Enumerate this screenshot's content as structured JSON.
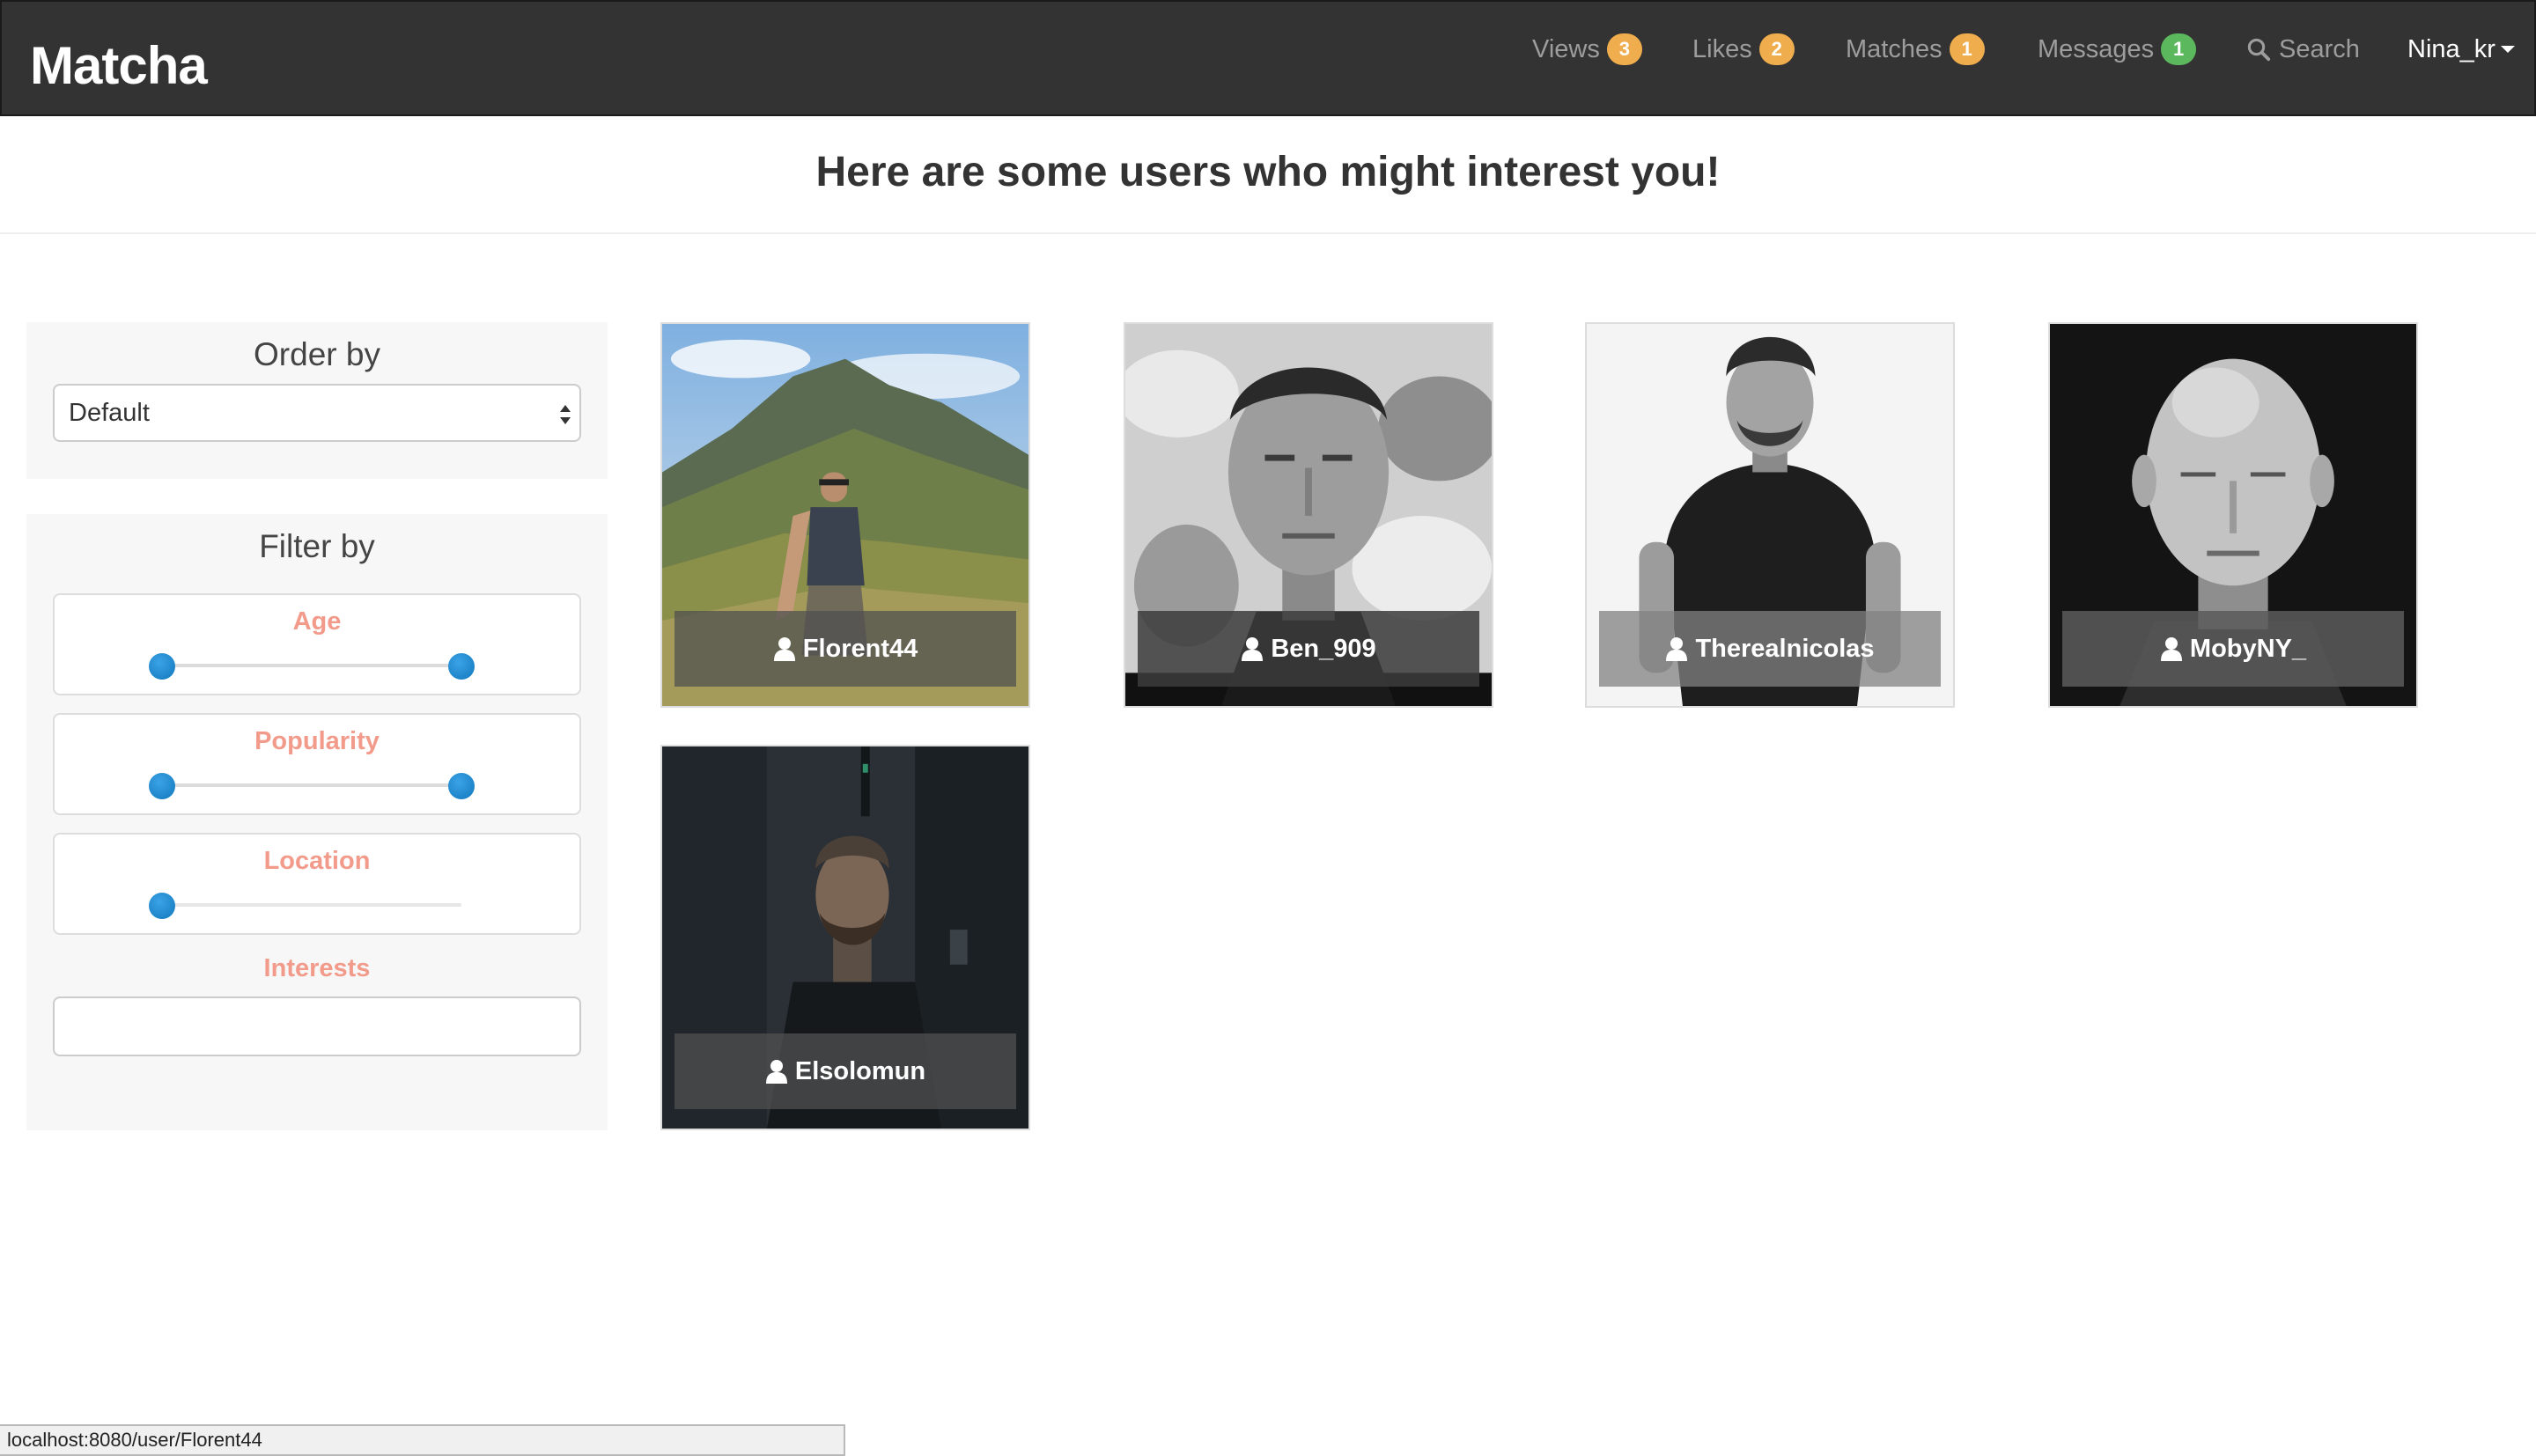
{
  "navbar": {
    "brand": "Matcha",
    "items": [
      {
        "label": "Views",
        "badge": "3",
        "badge_color": "#f0ad4e"
      },
      {
        "label": "Likes",
        "badge": "2",
        "badge_color": "#f0ad4e"
      },
      {
        "label": "Matches",
        "badge": "1",
        "badge_color": "#f0ad4e"
      },
      {
        "label": "Messages",
        "badge": "1",
        "badge_color": "#5cb85c"
      }
    ],
    "search_label": "Search",
    "search_icon": "search-icon",
    "user": "Nina_kr"
  },
  "headline": "Here are some users who might interest you!",
  "sidebar": {
    "order_title": "Order by",
    "order_selected": "Default",
    "filter_title": "Filter by",
    "filters": [
      {
        "label": "Age",
        "handles": [
          0.0,
          1.0
        ]
      },
      {
        "label": "Popularity",
        "handles": [
          0.0,
          1.0
        ]
      },
      {
        "label": "Location",
        "handles": [
          0.0
        ]
      }
    ],
    "interests_label": "Interests",
    "interests_value": ""
  },
  "users": [
    {
      "username": "Florent44",
      "photo_theme": "mountain-landscape"
    },
    {
      "username": "Ben_909",
      "photo_theme": "grey-portrait"
    },
    {
      "username": "Therealnicolas",
      "photo_theme": "white-studio"
    },
    {
      "username": "MobyNY_",
      "photo_theme": "dark-portrait"
    },
    {
      "username": "Elsolomun",
      "photo_theme": "dark-street"
    }
  ],
  "status_bar": "localhost:8080/user/Florent44",
  "colors": {
    "navbar_bg": "#333333",
    "filter_label": "#f29b8b",
    "slider_handle": "#1a87cf",
    "badge_orange": "#f0ad4e",
    "badge_green": "#5cb85c"
  }
}
